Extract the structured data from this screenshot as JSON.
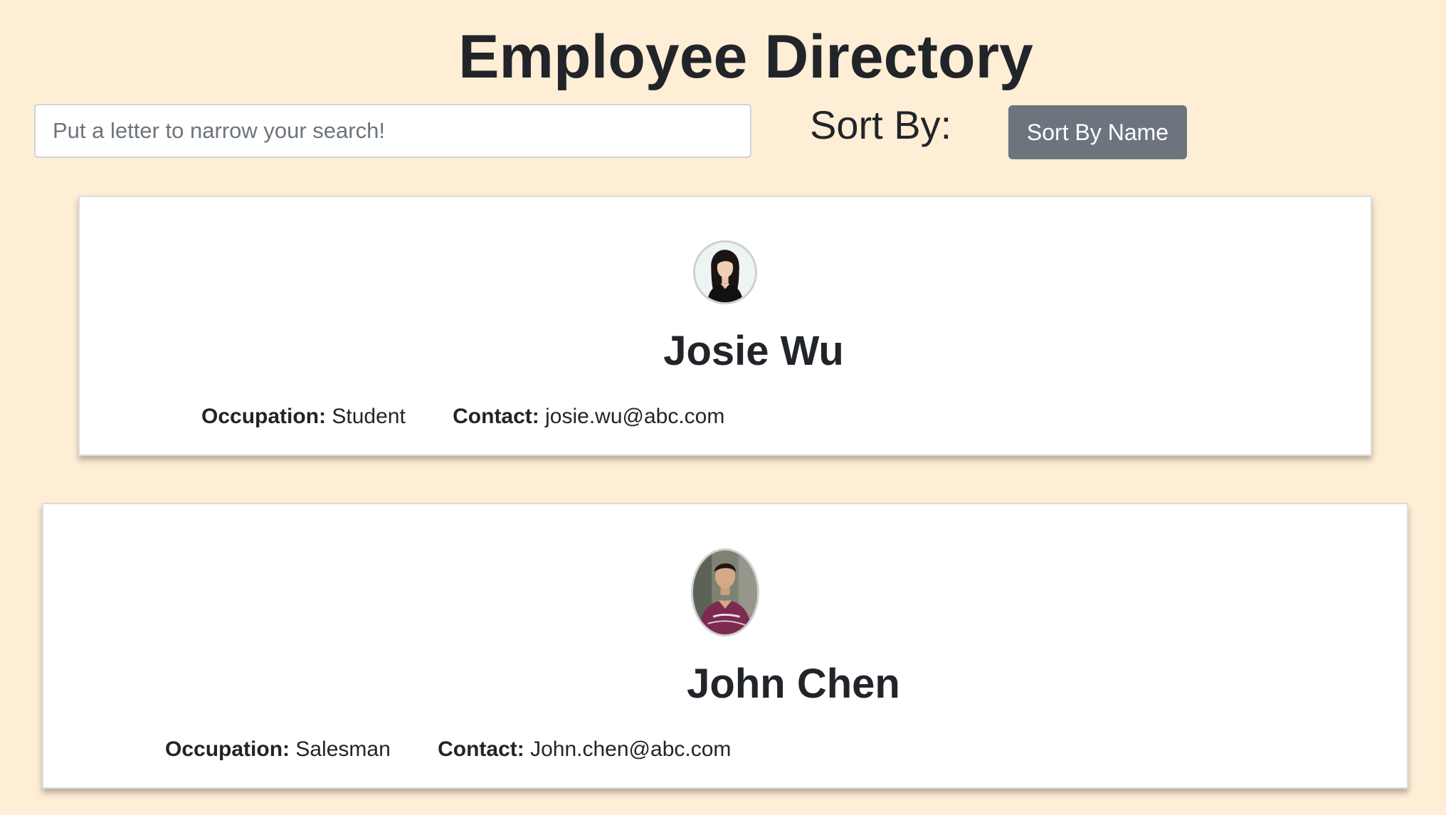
{
  "header": {
    "title": "Employee Directory"
  },
  "search": {
    "placeholder": "Put a letter to narrow your search!",
    "value": ""
  },
  "sort": {
    "label": "Sort By:",
    "button_label": "Sort By Name"
  },
  "employees": [
    {
      "name": "Josie Wu",
      "occupation_label": "Occupation:",
      "occupation": "Student",
      "contact_label": "Contact:",
      "contact": "josie.wu@abc.com",
      "avatar_icon": "profile-photo-woman"
    },
    {
      "name": "John Chen",
      "occupation_label": "Occupation:",
      "occupation": "Salesman",
      "contact_label": "Contact:",
      "contact": "John.chen@abc.com",
      "avatar_icon": "profile-photo-man"
    }
  ],
  "colors": {
    "background": "#ffeed6",
    "button": "#6c757d",
    "text": "#212529",
    "card": "#ffffff"
  }
}
